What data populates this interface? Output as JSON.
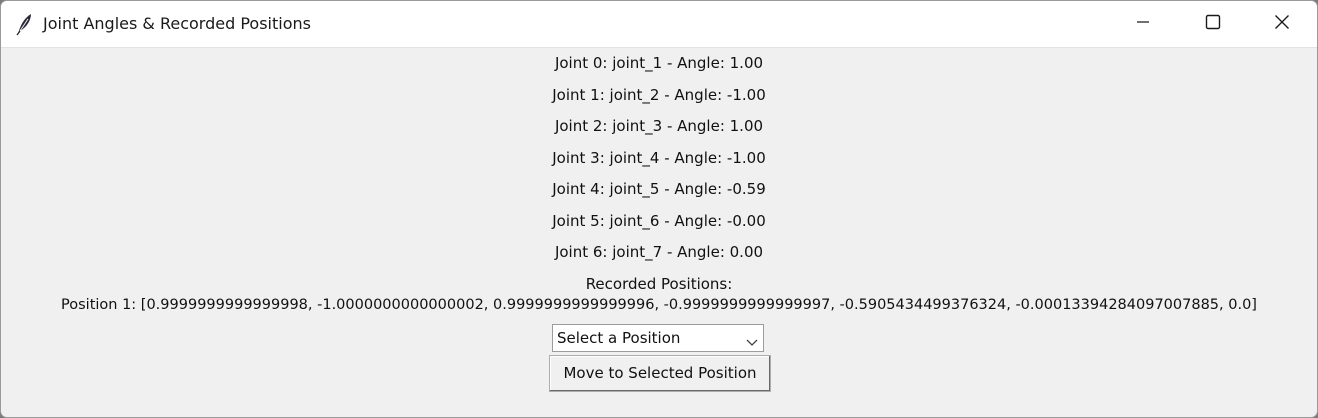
{
  "window": {
    "title": "Joint Angles & Recorded Positions",
    "icon": "feather-icon",
    "controls": [
      "minimize-icon",
      "maximize-icon",
      "close-icon"
    ]
  },
  "joints": [
    "Joint 0: joint_1 - Angle: 1.00",
    "Joint 1: joint_2 - Angle: -1.00",
    "Joint 2: joint_3 - Angle: 1.00",
    "Joint 3: joint_4 - Angle: -1.00",
    "Joint 4: joint_5 - Angle: -0.59",
    "Joint 5: joint_6 - Angle: -0.00",
    "Joint 6: joint_7 - Angle: 0.00"
  ],
  "recorded": {
    "title": "Recorded Positions:",
    "positions": [
      "Position 1: [0.9999999999999998, -1.0000000000000002, 0.9999999999999996, -0.9999999999999997, -0.5905434499376324, -0.00013394284097007885, 0.0]"
    ]
  },
  "selector": {
    "selected": "Select a Position"
  },
  "move_button": {
    "label": "Move to Selected Position"
  }
}
